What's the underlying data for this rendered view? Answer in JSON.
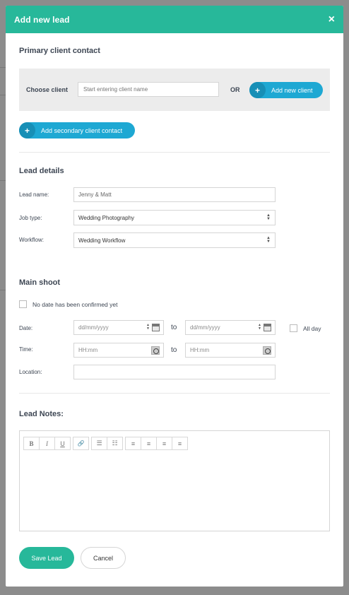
{
  "modal": {
    "title": "Add new lead",
    "close": "×"
  },
  "primary_contact": {
    "title": "Primary client contact",
    "choose_client_label": "Choose client",
    "client_placeholder": "Start entering client name",
    "or_label": "OR",
    "add_new_client_label": "Add new client",
    "add_secondary_label": "Add secondary client contact",
    "plus": "+"
  },
  "lead_details": {
    "title": "Lead details",
    "lead_name_label": "Lead name:",
    "lead_name_value": "Jenny & Matt",
    "job_type_label": "Job type:",
    "job_type_value": "Wedding Photography",
    "workflow_label": "Workflow:",
    "workflow_value": "Wedding Workflow"
  },
  "main_shoot": {
    "title": "Main shoot",
    "no_date_label": "No date has been confirmed yet",
    "date_label": "Date:",
    "date_placeholder": "dd/mm/yyyy",
    "to_label": "to",
    "all_day_label": "All day",
    "time_label": "Time:",
    "time_placeholder": "HH:mm",
    "location_label": "Location:"
  },
  "notes": {
    "title": "Lead Notes:",
    "toolbar": {
      "bold": "B",
      "italic": "I",
      "underline": "U",
      "link": "🔗",
      "bullet_list": "☰",
      "numbered_list": "☷",
      "align_left": "≡",
      "align_center": "≡",
      "align_right": "≡",
      "justify": "≡"
    }
  },
  "footer": {
    "save_label": "Save Lead",
    "cancel_label": "Cancel"
  },
  "colors": {
    "header": "#27b89a",
    "accent_blue": "#1ea8d3"
  }
}
